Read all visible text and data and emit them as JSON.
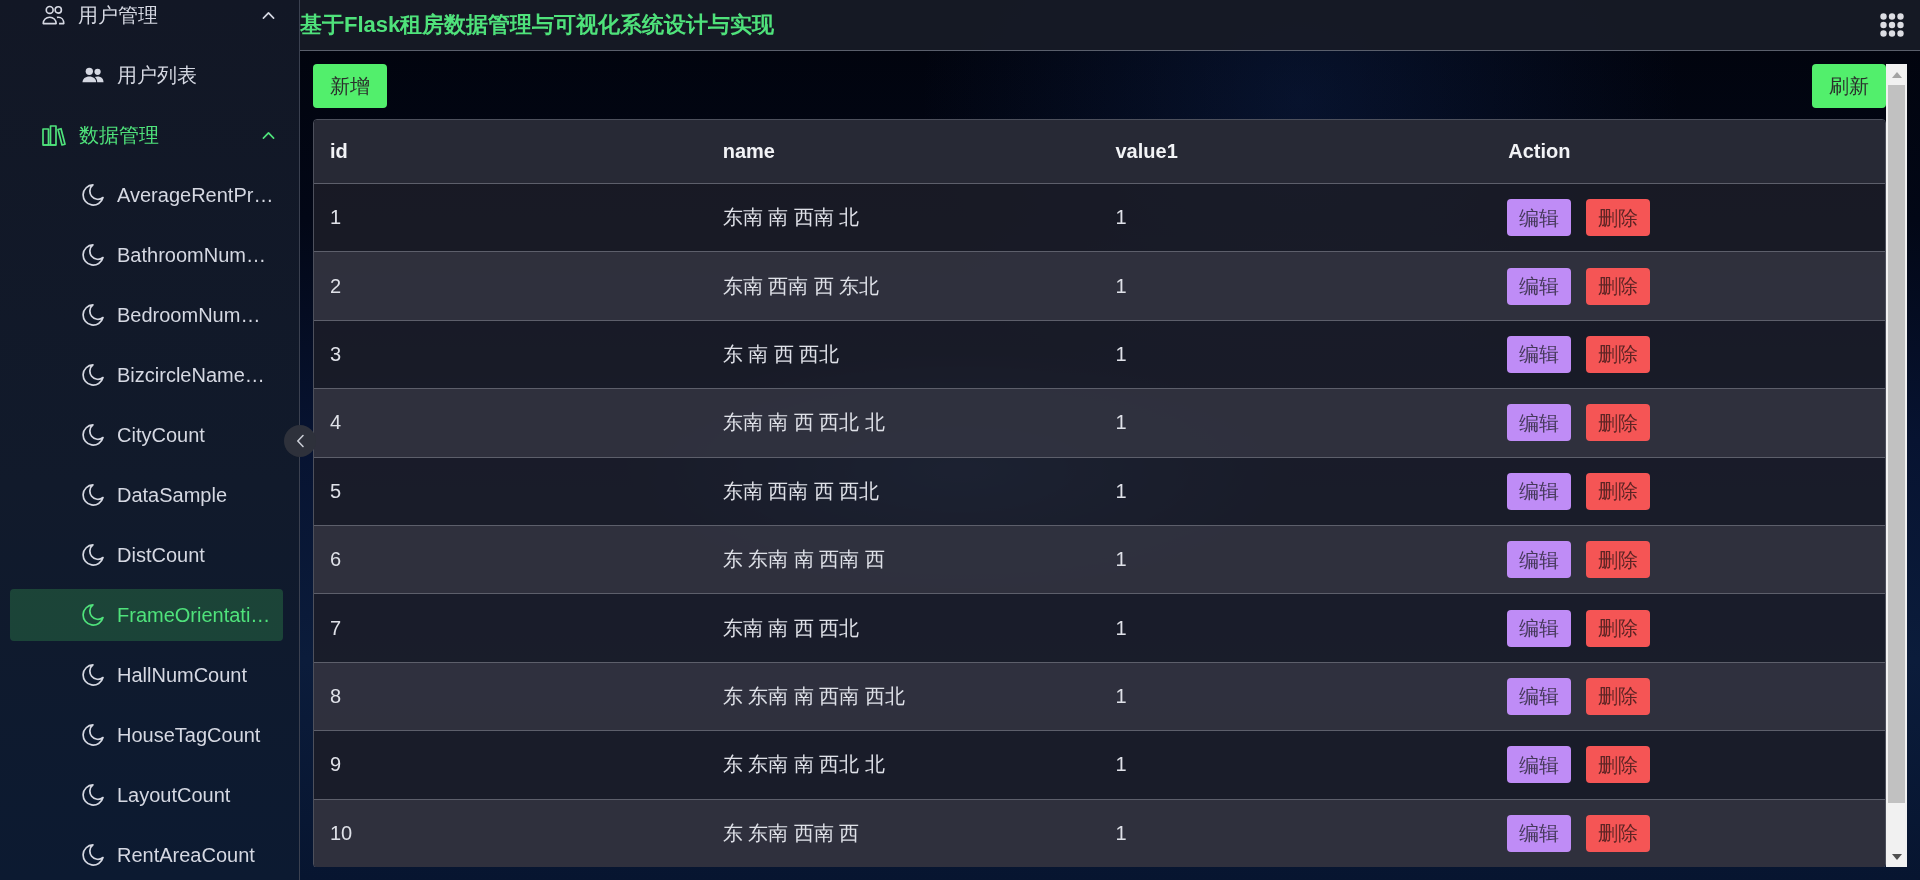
{
  "sidebar": {
    "groups": [
      {
        "label": "用户管理",
        "kind": "users",
        "expanded": true,
        "children": [
          {
            "label": "用户列表",
            "selected": false
          }
        ]
      },
      {
        "label": "数据管理",
        "kind": "data",
        "expanded": true,
        "children": [
          {
            "label": "AverageRentPr…",
            "selected": false
          },
          {
            "label": "BathroomNum…",
            "selected": false
          },
          {
            "label": "BedroomNum…",
            "selected": false
          },
          {
            "label": "BizcircleName…",
            "selected": false
          },
          {
            "label": "CityCount",
            "selected": false
          },
          {
            "label": "DataSample",
            "selected": false
          },
          {
            "label": "DistCount",
            "selected": false
          },
          {
            "label": "FrameOrientati…",
            "selected": true
          },
          {
            "label": "HallNumCount",
            "selected": false
          },
          {
            "label": "HouseTagCount",
            "selected": false
          },
          {
            "label": "LayoutCount",
            "selected": false
          },
          {
            "label": "RentAreaCount",
            "selected": false
          }
        ]
      }
    ]
  },
  "header": {
    "title": "基于Flask租房数据管理与可视化系统设计与实现"
  },
  "toolbar": {
    "add_button": "新增",
    "refresh_button": "刷新"
  },
  "table": {
    "columns": [
      "id",
      "name",
      "value1",
      "Action"
    ],
    "rows": [
      {
        "id": "1",
        "name": "东南 南 西南 北",
        "value1": "1",
        "actions": [
          {
            "label": "编辑",
            "kind": "edit"
          },
          {
            "label": "删除",
            "kind": "delete"
          }
        ]
      },
      {
        "id": "2",
        "name": "东南 西南 西 东北",
        "value1": "1",
        "actions": [
          {
            "label": "编辑",
            "kind": "edit"
          },
          {
            "label": "删除",
            "kind": "delete"
          }
        ]
      },
      {
        "id": "3",
        "name": "东 南 西 西北",
        "value1": "1",
        "actions": [
          {
            "label": "编辑",
            "kind": "edit"
          },
          {
            "label": "删除",
            "kind": "delete"
          }
        ]
      },
      {
        "id": "4",
        "name": "东南 南 西 西北 北",
        "value1": "1",
        "actions": [
          {
            "label": "编辑",
            "kind": "edit"
          },
          {
            "label": "删除",
            "kind": "delete"
          }
        ]
      },
      {
        "id": "5",
        "name": "东南 西南 西 西北",
        "value1": "1",
        "actions": [
          {
            "label": "编辑",
            "kind": "edit"
          },
          {
            "label": "删除",
            "kind": "delete"
          }
        ]
      },
      {
        "id": "6",
        "name": "东 东南 南 西南 西",
        "value1": "1",
        "actions": [
          {
            "label": "编辑",
            "kind": "edit"
          },
          {
            "label": "删除",
            "kind": "delete"
          }
        ]
      },
      {
        "id": "7",
        "name": "东南 南 西 西北",
        "value1": "1",
        "actions": [
          {
            "label": "编辑",
            "kind": "edit"
          },
          {
            "label": "删除",
            "kind": "delete"
          }
        ]
      },
      {
        "id": "8",
        "name": "东 东南 南 西南 西北",
        "value1": "1",
        "actions": [
          {
            "label": "编辑",
            "kind": "edit"
          },
          {
            "label": "删除",
            "kind": "delete"
          }
        ]
      },
      {
        "id": "9",
        "name": "东 东南 南 西北 北",
        "value1": "1",
        "actions": [
          {
            "label": "编辑",
            "kind": "edit"
          },
          {
            "label": "删除",
            "kind": "delete"
          }
        ]
      },
      {
        "id": "10",
        "name": "东 东南 西南 西",
        "value1": "1",
        "actions": [
          {
            "label": "编辑",
            "kind": "edit"
          },
          {
            "label": "删除",
            "kind": "delete"
          }
        ]
      }
    ]
  }
}
